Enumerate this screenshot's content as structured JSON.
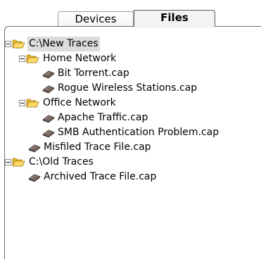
{
  "tabs": {
    "devices_label": "Devices",
    "files_label": "Files",
    "active": "Files"
  },
  "tree": [
    {
      "depth": 0,
      "type": "folder",
      "expanded": true,
      "label": "C:\\New Traces",
      "selected": true
    },
    {
      "depth": 1,
      "type": "folder",
      "expanded": true,
      "label": "Home Network"
    },
    {
      "depth": 2,
      "type": "file",
      "label": "Bit Torrent.cap"
    },
    {
      "depth": 2,
      "type": "file",
      "label": "Rogue Wireless Stations.cap"
    },
    {
      "depth": 1,
      "type": "folder",
      "expanded": true,
      "label": "Office Network"
    },
    {
      "depth": 2,
      "type": "file",
      "label": "Apache Traffic.cap"
    },
    {
      "depth": 2,
      "type": "file",
      "label": "SMB Authentication Problem.cap"
    },
    {
      "depth": 1,
      "type": "file",
      "label": "Misfiled Trace File.cap"
    },
    {
      "depth": 0,
      "type": "folder",
      "expanded": true,
      "label": "C:\\Old Traces"
    },
    {
      "depth": 1,
      "type": "file",
      "label": "Archived Trace File.cap"
    }
  ],
  "icons": {
    "folder": "folder-open-icon",
    "file": "capture-file-icon",
    "toggle": "collapse-toggle-icon"
  }
}
